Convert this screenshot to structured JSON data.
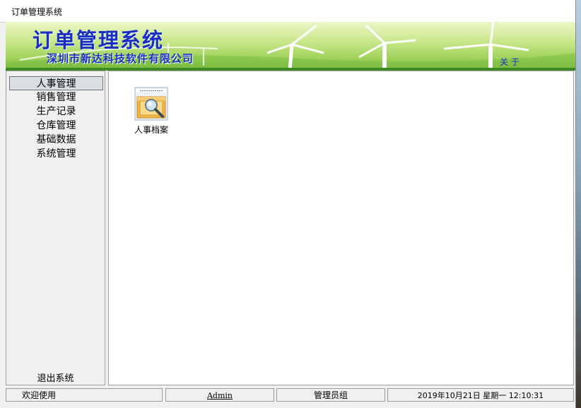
{
  "window": {
    "title": "订单管理系统"
  },
  "banner": {
    "app_title": "订单管理系统",
    "company": "深圳市新达科技软件有限公司",
    "about": "关 于"
  },
  "sidebar": {
    "items": [
      {
        "label": "人事管理",
        "selected": true
      },
      {
        "label": "销售管理",
        "selected": false
      },
      {
        "label": "生产记录",
        "selected": false
      },
      {
        "label": "仓库管理",
        "selected": false
      },
      {
        "label": "基础数据",
        "selected": false
      },
      {
        "label": "系统管理",
        "selected": false
      }
    ],
    "exit": "退出系统"
  },
  "main": {
    "modules": [
      {
        "label": "人事档案",
        "icon": "personnel-file-icon"
      }
    ]
  },
  "statusbar": {
    "welcome": "欢迎使用",
    "user": "Admin",
    "group": "管理员组",
    "datetime": "2019年10月21日 星期一 12:10:31"
  },
  "colors": {
    "title_blue": "#1a2fc2",
    "banner_green": "#9fd25a",
    "selected_item": "#d8dde6"
  }
}
